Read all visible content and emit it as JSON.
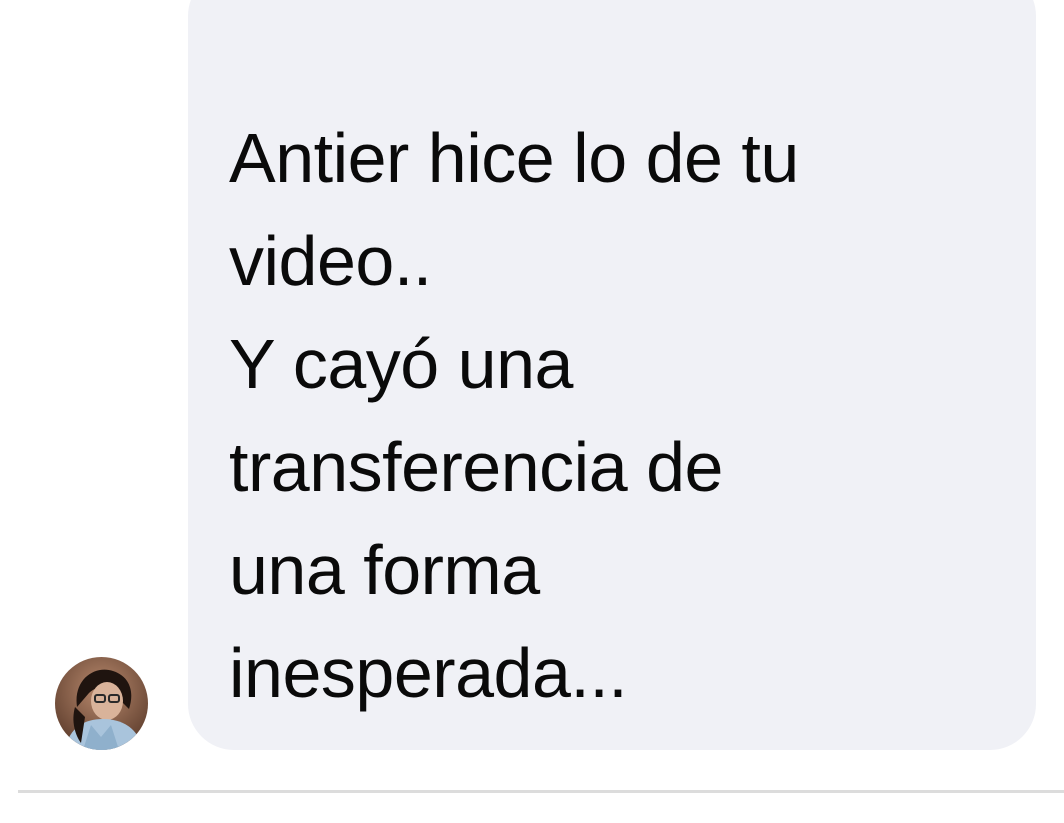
{
  "conversation": {
    "incoming_message": {
      "lines": [
        "Antier hice lo de tu",
        "video..",
        "Y cayó una",
        "transferencia de",
        "una forma",
        "inesperada..."
      ]
    },
    "colors": {
      "bubble_background": "#f0f1f6",
      "text": "#0a0a0a",
      "divider": "#dcdcdc",
      "page_background": "#ffffff"
    },
    "avatar": {
      "icon": "user-profile-photo"
    }
  }
}
